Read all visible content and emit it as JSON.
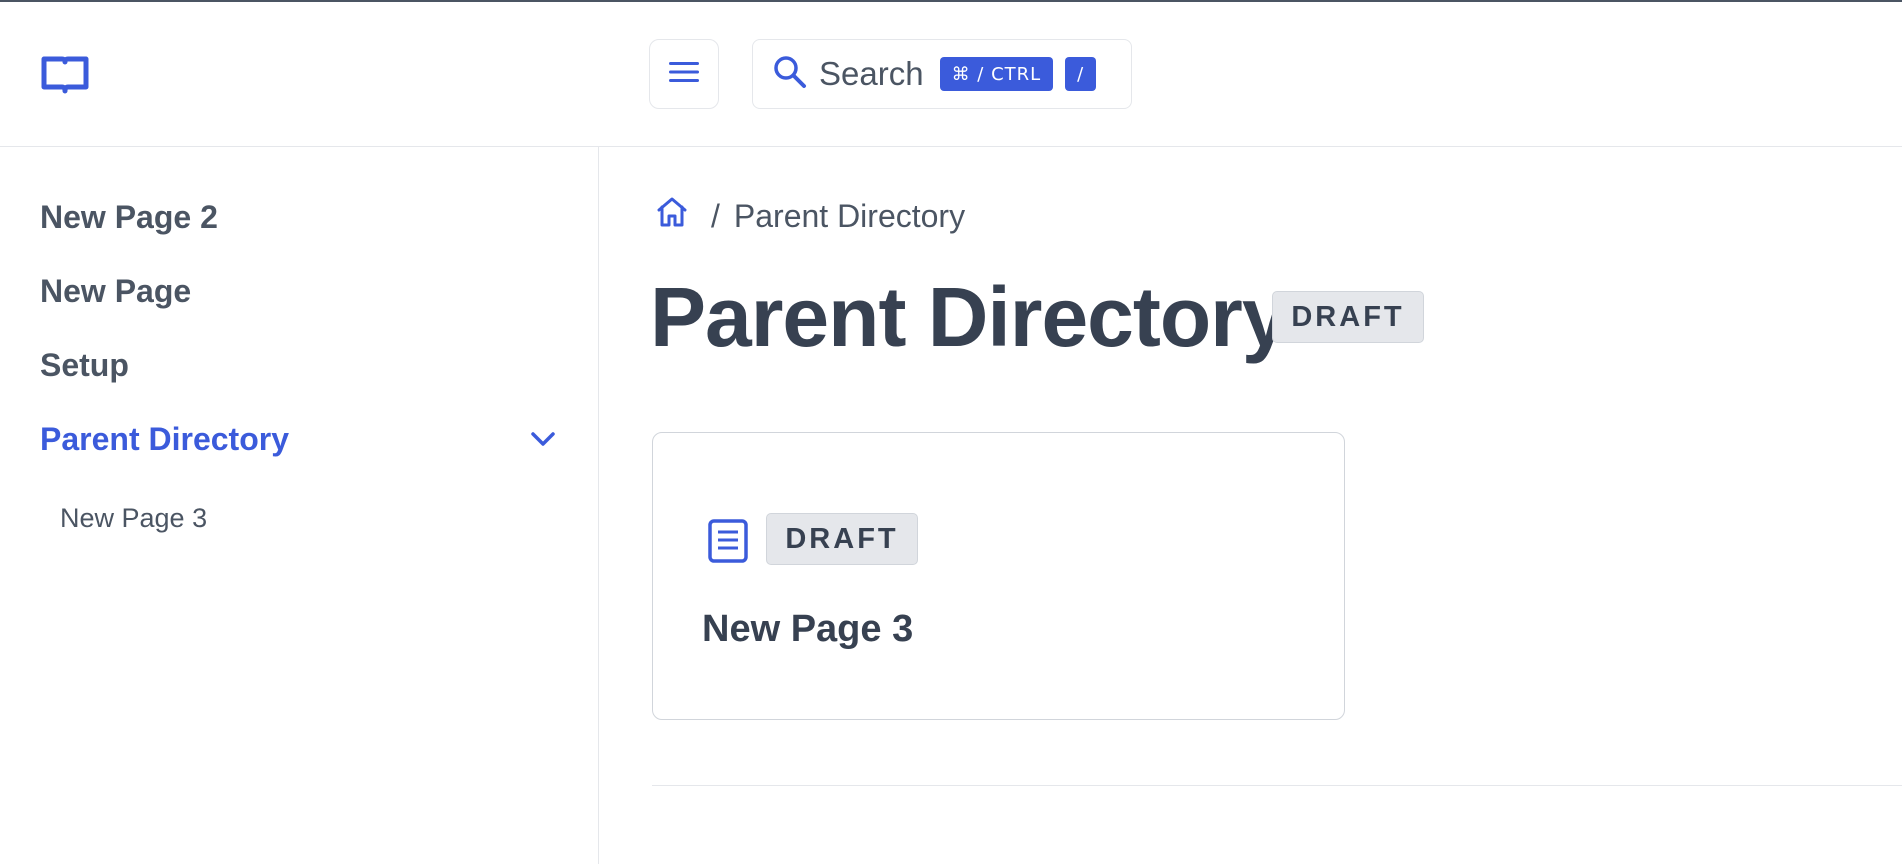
{
  "header": {
    "search_placeholder": "Search",
    "shortcut_primary": "⌘ / CTRL",
    "shortcut_secondary": "/"
  },
  "sidebar": {
    "items": [
      {
        "label": "New Page 2"
      },
      {
        "label": "New Page"
      },
      {
        "label": "Setup"
      },
      {
        "label": "Parent Directory"
      }
    ],
    "sub_items": [
      {
        "label": "New Page 3"
      }
    ]
  },
  "breadcrumb": {
    "separator": "/",
    "current": "Parent Directory"
  },
  "main": {
    "title": "Parent Directory",
    "status_badge": "DRAFT",
    "cards": [
      {
        "badge": "DRAFT",
        "title": "New Page 3"
      }
    ]
  },
  "colors": {
    "accent": "#3b5bdb",
    "text": "#374151",
    "muted": "#4b5563",
    "border": "#e5e7eb"
  },
  "icons": [
    "book-logo-icon",
    "hamburger-menu-icon",
    "search-icon",
    "home-icon",
    "chevron-down-icon",
    "document-icon"
  ]
}
